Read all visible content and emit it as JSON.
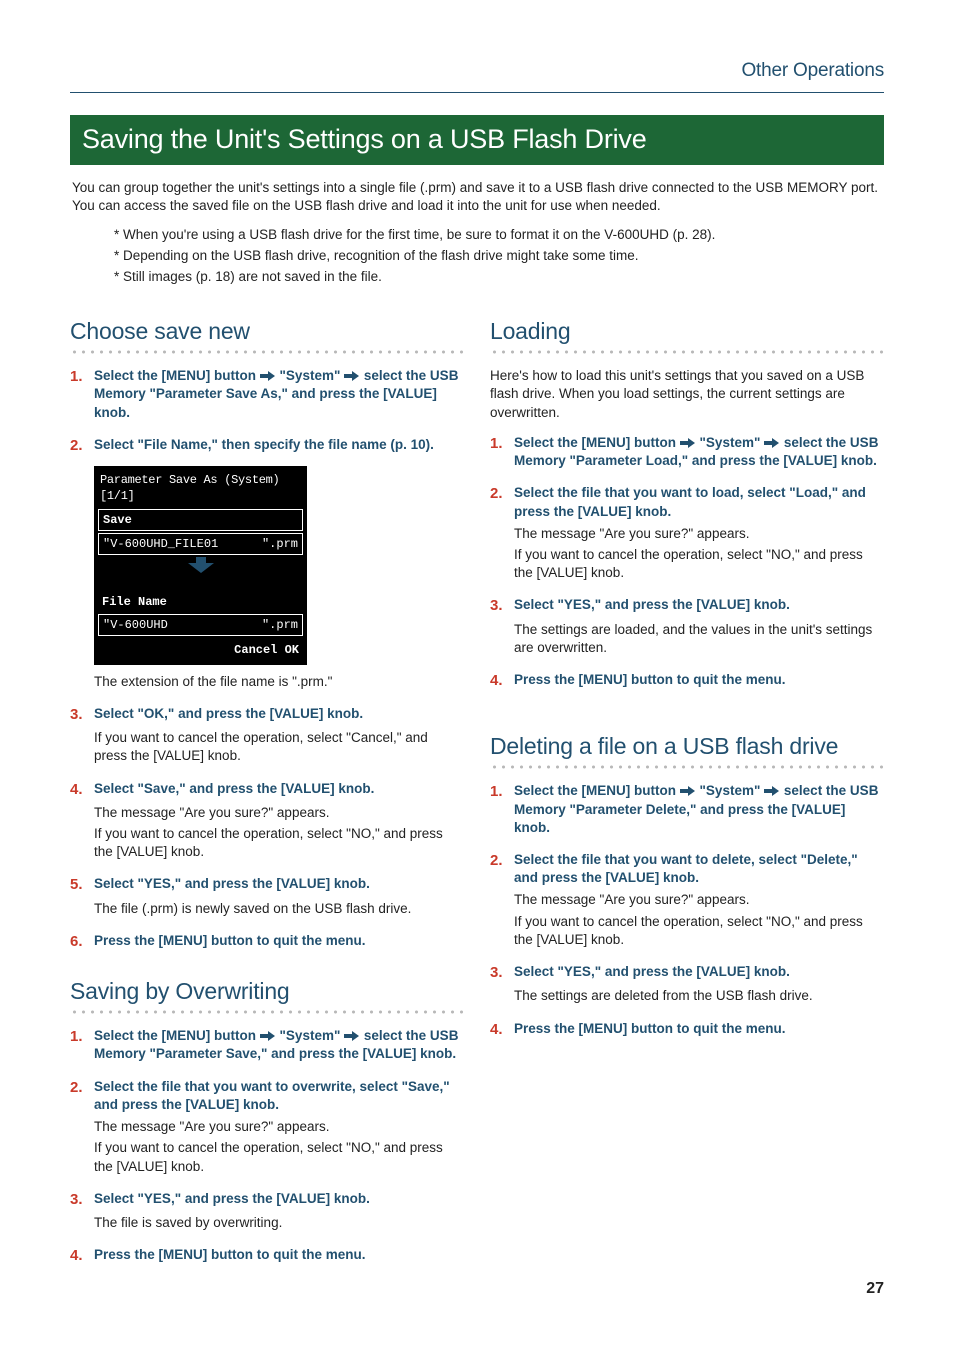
{
  "header": {
    "running_head": "Other Operations"
  },
  "title": "Saving the Unit's Settings on a USB Flash Drive",
  "intro": "You can group together the unit's settings into a single file (.prm) and save it to a USB flash drive connected to the USB MEMORY port. You can access the saved file on the USB flash drive and load it into the unit for use when needed.",
  "notes": [
    "When you're using a USB flash drive for the first time, be sure to format it on the V-600UHD (p. 28).",
    "Depending on the USB flash drive, recognition of the flash drive might take some time.",
    "Still images (p. 18) are not saved in the file."
  ],
  "save_new": {
    "heading": "Choose save new",
    "steps": {
      "s1a": "Select the [MENU] button",
      "s1b": "\"System\"",
      "s1c": "select the USB Memory \"Parameter Save As,\" and press the [VALUE] knob.",
      "s2": "Select \"File Name,\" then specify the file name (p. 10).",
      "s2_below": "The extension of the file name is \".prm.\"",
      "s3": "Select \"OK,\" and press the [VALUE] knob.",
      "s3_sub": "If you want to cancel the operation, select \"Cancel,\" and press the [VALUE] knob.",
      "s4": "Select \"Save,\" and press the [VALUE] knob.",
      "s4_sub1": "The message \"Are you sure?\" appears.",
      "s4_sub2": "If you want to cancel the operation, select \"NO,\" and press the [VALUE] knob.",
      "s5": "Select \"YES,\" and press the [VALUE] knob.",
      "s5_sub": "The file (.prm) is newly saved on the USB flash drive.",
      "s6": "Press the [MENU] button to quit the menu."
    },
    "device": {
      "title": "Parameter Save As (System) [1/1]",
      "save": "Save",
      "file": "\"V-600UHD_FILE01",
      "ext": "\".prm",
      "section": "File Name",
      "name": "\"V-600UHD",
      "name_ext": "\".prm",
      "cancel": "Cancel",
      "ok": "OK"
    }
  },
  "overwrite": {
    "heading": "Saving by Overwriting",
    "steps": {
      "s1a": "Select the [MENU] button",
      "s1b": "\"System\"",
      "s1c": "select the USB Memory \"Parameter Save,\" and press the [VALUE] knob.",
      "s2": "Select the file that you want to overwrite, select \"Save,\" and press the [VALUE] knob.",
      "s2_sub1": "The message \"Are you sure?\" appears.",
      "s2_sub2": "If you want to cancel the operation, select \"NO,\" and press the [VALUE] knob.",
      "s3": "Select \"YES,\" and press the [VALUE] knob.",
      "s3_sub": "The file is saved by overwriting.",
      "s4": "Press the [MENU] button to quit the menu."
    }
  },
  "loading": {
    "heading": "Loading",
    "intro": "Here's how to load this unit's settings that you saved on a USB flash drive. When you load settings, the current settings are overwritten.",
    "steps": {
      "s1a": "Select the [MENU] button",
      "s1b": "\"System\"",
      "s1c": "select the USB Memory \"Parameter Load,\" and press the [VALUE] knob.",
      "s2": "Select the file that you want to load, select \"Load,\" and press the [VALUE] knob.",
      "s2_sub1": "The message \"Are you sure?\" appears.",
      "s2_sub2": "If you want to cancel the operation, select \"NO,\" and press the [VALUE] knob.",
      "s3": "Select \"YES,\" and press the [VALUE] knob.",
      "s3_sub": "The settings are loaded, and the values in the unit's settings are overwritten.",
      "s4": "Press the [MENU] button to quit the menu."
    }
  },
  "deleting": {
    "heading": "Deleting a file on a USB flash drive",
    "steps": {
      "s1a": "Select the [MENU] button",
      "s1b": "\"System\"",
      "s1c": "select the USB Memory \"Parameter Delete,\" and press the [VALUE] knob.",
      "s2": "Select the file that you want to delete, select \"Delete,\" and press the [VALUE] knob.",
      "s2_sub1": "The message \"Are you sure?\" appears.",
      "s2_sub2": "If you want to cancel the operation, select \"NO,\" and press the [VALUE] knob.",
      "s3": "Select \"YES,\" and press the [VALUE] knob.",
      "s3_sub": "The settings are deleted from the USB flash drive.",
      "s4": "Press the [MENU] button to quit the menu."
    }
  },
  "page_number": "27"
}
